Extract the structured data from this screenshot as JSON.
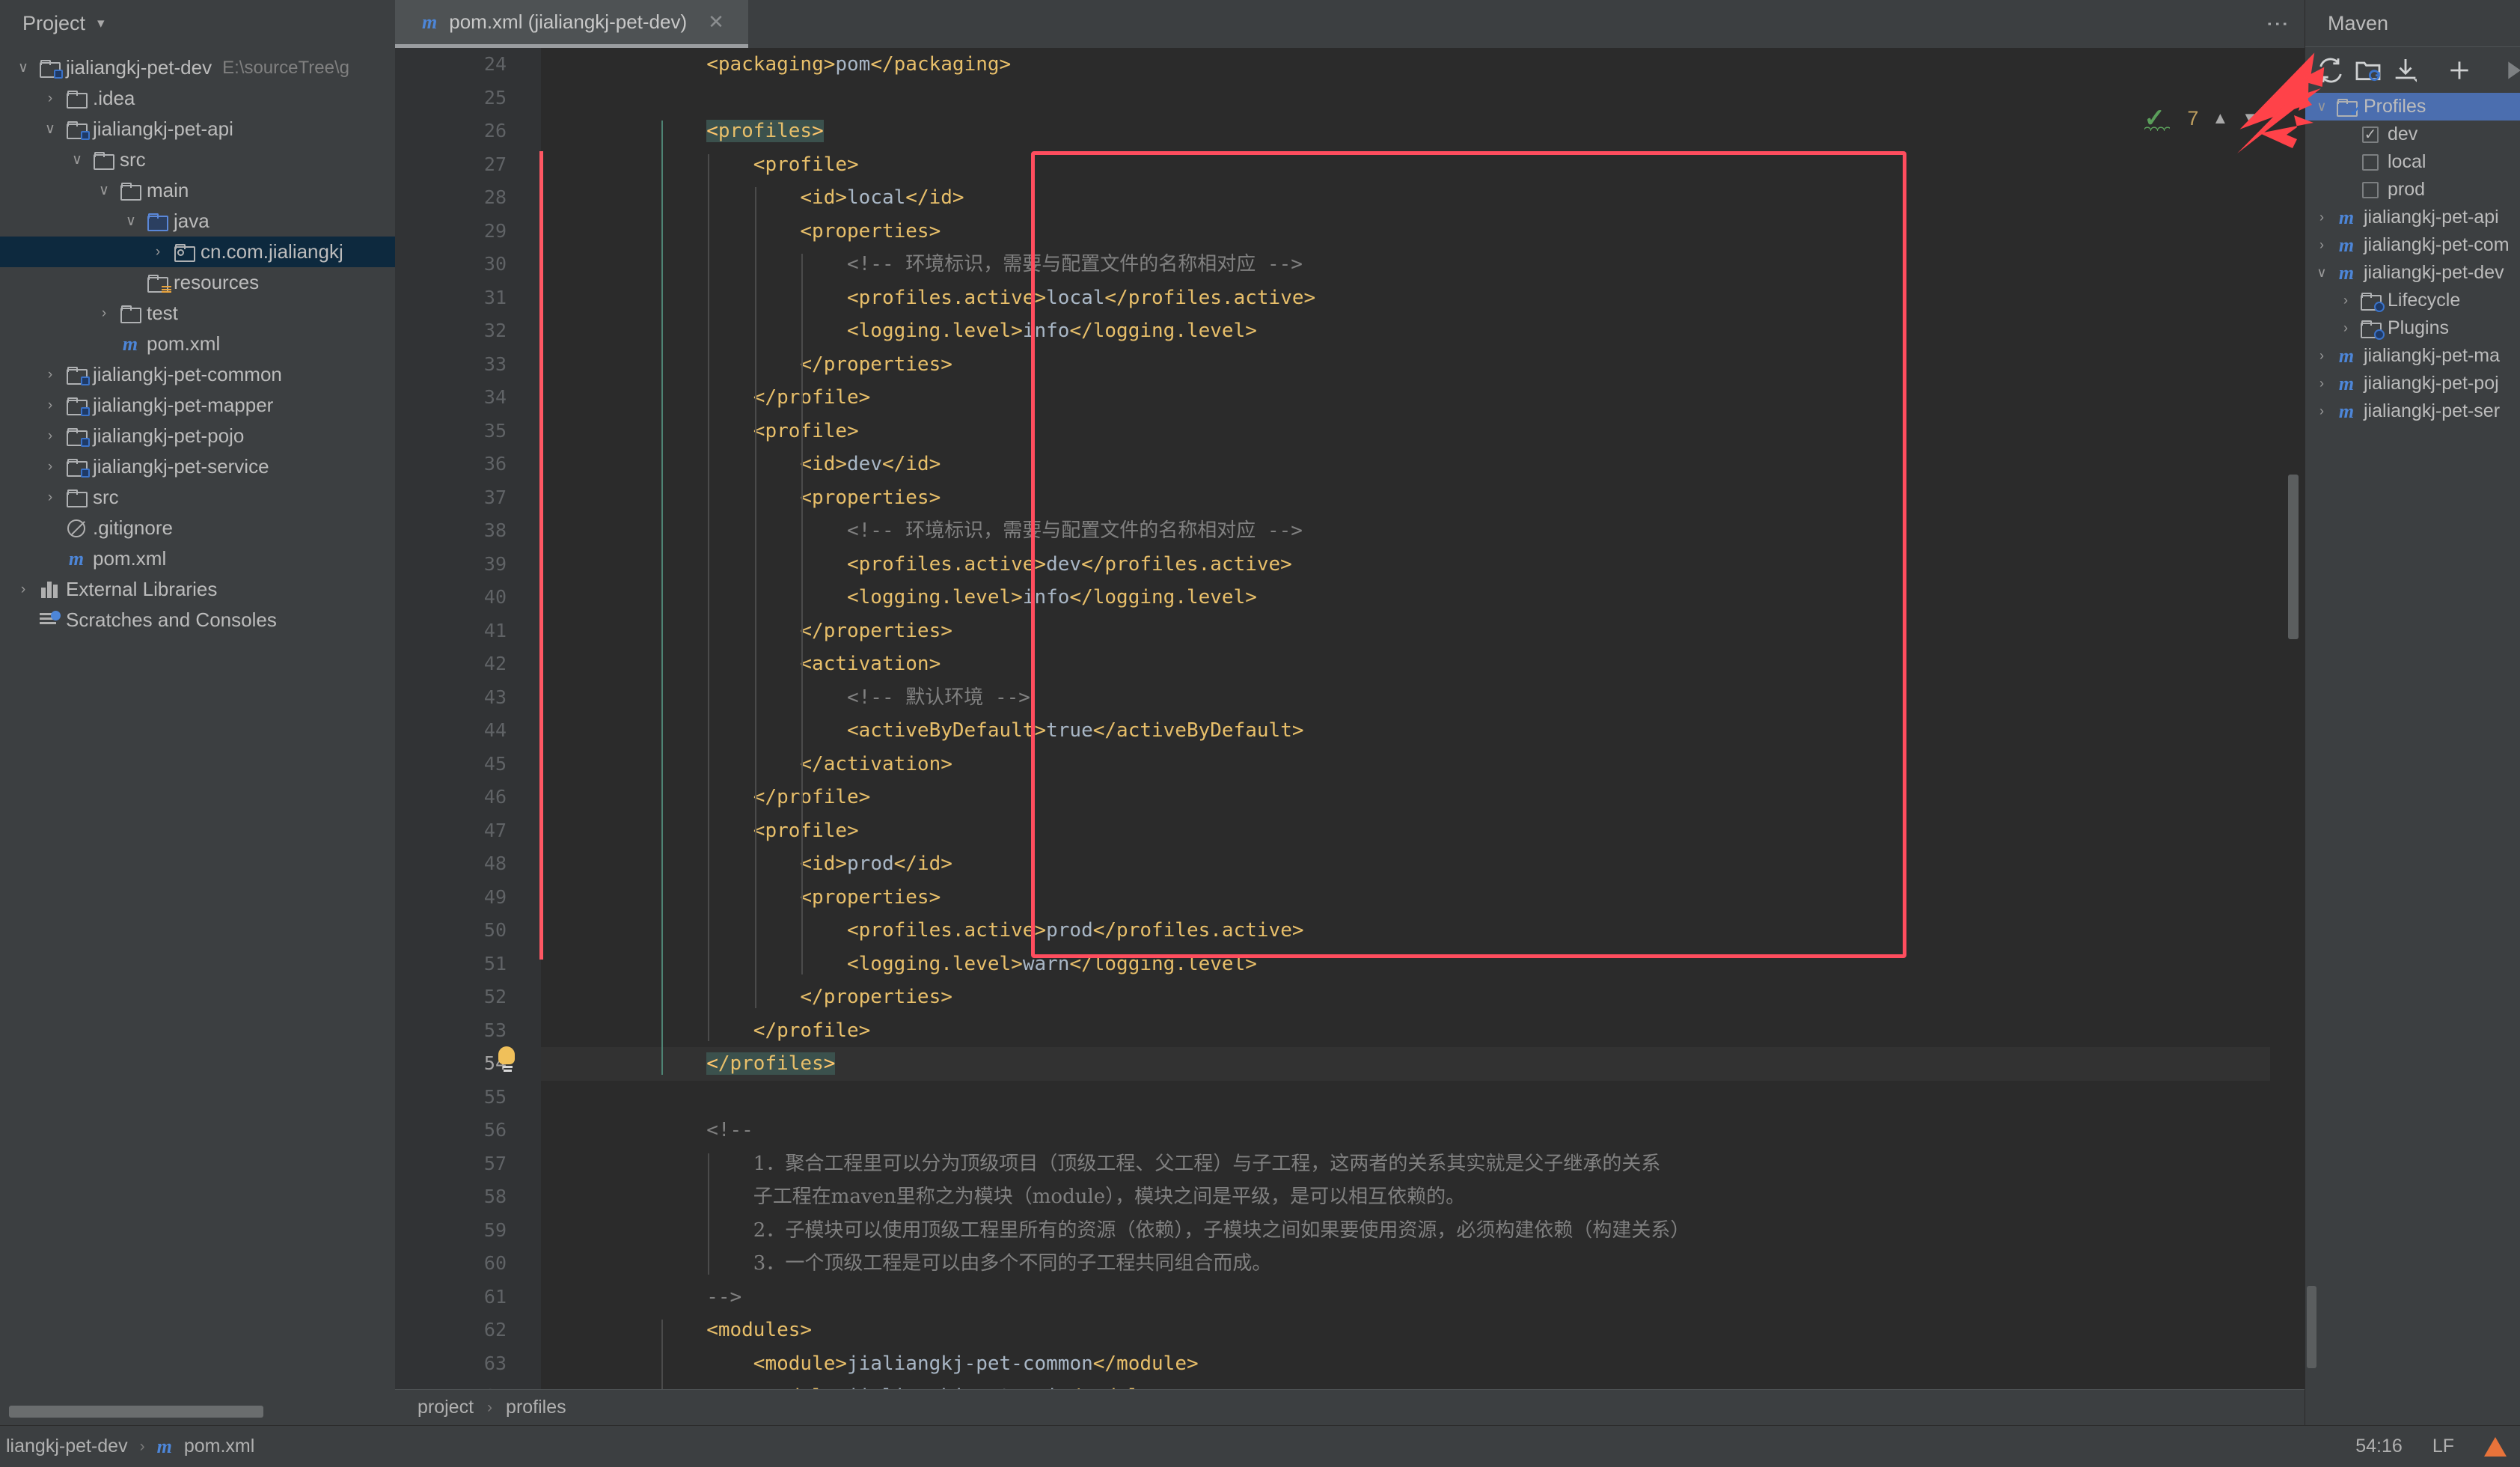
{
  "project_panel": {
    "title": "Project",
    "caret_icon": "chevron-down-icon",
    "tree": [
      {
        "id": "root",
        "label": "jialiangkj-pet-dev",
        "path": "E:\\sourceTree\\g",
        "indent": 0,
        "arrow": "v",
        "icon": "module-folder-icon"
      },
      {
        "id": "idea",
        "label": ".idea",
        "indent": 1,
        "arrow": ">",
        "icon": "folder-icon"
      },
      {
        "id": "api",
        "label": "jialiangkj-pet-api",
        "indent": 1,
        "arrow": "v",
        "icon": "module-folder-icon"
      },
      {
        "id": "src",
        "label": "src",
        "indent": 2,
        "arrow": "v",
        "icon": "folder-icon"
      },
      {
        "id": "main",
        "label": "main",
        "indent": 3,
        "arrow": "v",
        "icon": "folder-icon"
      },
      {
        "id": "java",
        "label": "java",
        "indent": 4,
        "arrow": "v",
        "icon": "source-folder-icon"
      },
      {
        "id": "pkg",
        "label": "cn.com.jialiangkj",
        "indent": 5,
        "arrow": ">",
        "icon": "package-icon",
        "selected": true
      },
      {
        "id": "resources",
        "label": "resources",
        "indent": 4,
        "arrow": "",
        "icon": "resources-folder-icon"
      },
      {
        "id": "test",
        "label": "test",
        "indent": 3,
        "arrow": ">",
        "icon": "folder-icon"
      },
      {
        "id": "api-pom",
        "label": "pom.xml",
        "indent": 3,
        "arrow": "",
        "icon": "maven-file-icon"
      },
      {
        "id": "common",
        "label": "jialiangkj-pet-common",
        "indent": 1,
        "arrow": ">",
        "icon": "module-folder-icon"
      },
      {
        "id": "mapper",
        "label": "jialiangkj-pet-mapper",
        "indent": 1,
        "arrow": ">",
        "icon": "module-folder-icon"
      },
      {
        "id": "pojo",
        "label": "jialiangkj-pet-pojo",
        "indent": 1,
        "arrow": ">",
        "icon": "module-folder-icon"
      },
      {
        "id": "service",
        "label": "jialiangkj-pet-service",
        "indent": 1,
        "arrow": ">",
        "icon": "module-folder-icon"
      },
      {
        "id": "rootsrc",
        "label": "src",
        "indent": 1,
        "arrow": ">",
        "icon": "folder-icon"
      },
      {
        "id": "gitignore",
        "label": ".gitignore",
        "indent": 1,
        "arrow": "",
        "icon": "gitignore-icon"
      },
      {
        "id": "rootpom",
        "label": "pom.xml",
        "indent": 1,
        "arrow": "",
        "icon": "maven-file-icon"
      },
      {
        "id": "extlibs",
        "label": "External Libraries",
        "indent": 0,
        "arrow": ">",
        "icon": "library-icon"
      },
      {
        "id": "scratches",
        "label": "Scratches and Consoles",
        "indent": 0,
        "arrow": "",
        "icon": "scratches-icon"
      }
    ]
  },
  "editor": {
    "tab": {
      "label": "pom.xml (jialiangkj-pet-dev)",
      "icon": "maven-file-icon",
      "close_icon": "close-icon"
    },
    "tab_options_icon": "more-options-icon",
    "inspection": {
      "count": "7",
      "status_icon": "inspection-ok-icon",
      "up_icon": "chevron-up-icon",
      "down_icon": "chevron-down-icon"
    },
    "first_line_number": 24,
    "current_line": 54,
    "bulb_icon": "intention-bulb-icon",
    "lines": [
      {
        "n": 24,
        "indent": 2,
        "parts": [
          {
            "t": "tag",
            "s": "<packaging>"
          },
          {
            "t": "val",
            "s": "pom"
          },
          {
            "t": "tag",
            "s": "</packaging>"
          }
        ]
      },
      {
        "n": 25,
        "indent": 0,
        "parts": []
      },
      {
        "n": 26,
        "indent": 2,
        "hl": true,
        "parts": [
          {
            "t": "brk",
            "s": "<"
          },
          {
            "t": "tag",
            "s": "profiles"
          },
          {
            "t": "brk",
            "s": ">"
          }
        ]
      },
      {
        "n": 27,
        "indent": 3,
        "parts": [
          {
            "t": "tag",
            "s": "<profile>"
          }
        ]
      },
      {
        "n": 28,
        "indent": 4,
        "parts": [
          {
            "t": "tag",
            "s": "<id>"
          },
          {
            "t": "val",
            "s": "local"
          },
          {
            "t": "tag",
            "s": "</id>"
          }
        ]
      },
      {
        "n": 29,
        "indent": 4,
        "parts": [
          {
            "t": "tag",
            "s": "<properties>"
          }
        ]
      },
      {
        "n": 30,
        "indent": 5,
        "parts": [
          {
            "t": "cmt",
            "s": "<!-- "
          },
          {
            "t": "cjk",
            "s": "环境标识，需要与配置文件的名称相对应"
          },
          {
            "t": "cmt",
            "s": " -->"
          }
        ]
      },
      {
        "n": 31,
        "indent": 5,
        "parts": [
          {
            "t": "tag",
            "s": "<profiles.active>"
          },
          {
            "t": "val",
            "s": "local"
          },
          {
            "t": "tag",
            "s": "</profiles.active>"
          }
        ]
      },
      {
        "n": 32,
        "indent": 5,
        "parts": [
          {
            "t": "tag",
            "s": "<logging.level>"
          },
          {
            "t": "val",
            "s": "info"
          },
          {
            "t": "tag",
            "s": "</logging.level>"
          }
        ]
      },
      {
        "n": 33,
        "indent": 4,
        "parts": [
          {
            "t": "tag",
            "s": "</properties>"
          }
        ]
      },
      {
        "n": 34,
        "indent": 3,
        "parts": [
          {
            "t": "tag",
            "s": "</profile>"
          }
        ]
      },
      {
        "n": 35,
        "indent": 3,
        "parts": [
          {
            "t": "tag",
            "s": "<profile>"
          }
        ]
      },
      {
        "n": 36,
        "indent": 4,
        "parts": [
          {
            "t": "tag",
            "s": "<id>"
          },
          {
            "t": "val",
            "s": "dev"
          },
          {
            "t": "tag",
            "s": "</id>"
          }
        ]
      },
      {
        "n": 37,
        "indent": 4,
        "parts": [
          {
            "t": "tag",
            "s": "<properties>"
          }
        ]
      },
      {
        "n": 38,
        "indent": 5,
        "parts": [
          {
            "t": "cmt",
            "s": "<!-- "
          },
          {
            "t": "cjk",
            "s": "环境标识，需要与配置文件的名称相对应"
          },
          {
            "t": "cmt",
            "s": " -->"
          }
        ]
      },
      {
        "n": 39,
        "indent": 5,
        "parts": [
          {
            "t": "tag",
            "s": "<profiles.active>"
          },
          {
            "t": "val",
            "s": "dev"
          },
          {
            "t": "tag",
            "s": "</profiles.active>"
          }
        ]
      },
      {
        "n": 40,
        "indent": 5,
        "parts": [
          {
            "t": "tag",
            "s": "<logging.level>"
          },
          {
            "t": "val",
            "s": "info"
          },
          {
            "t": "tag",
            "s": "</logging.level>"
          }
        ]
      },
      {
        "n": 41,
        "indent": 4,
        "parts": [
          {
            "t": "tag",
            "s": "</properties>"
          }
        ]
      },
      {
        "n": 42,
        "indent": 4,
        "parts": [
          {
            "t": "tag",
            "s": "<activation>"
          }
        ]
      },
      {
        "n": 43,
        "indent": 5,
        "parts": [
          {
            "t": "cmt",
            "s": "<!-- "
          },
          {
            "t": "cjk",
            "s": "默认环境"
          },
          {
            "t": "cmt",
            "s": " -->"
          }
        ]
      },
      {
        "n": 44,
        "indent": 5,
        "parts": [
          {
            "t": "tag",
            "s": "<activeByDefault>"
          },
          {
            "t": "val",
            "s": "true"
          },
          {
            "t": "tag",
            "s": "</activeByDefault>"
          }
        ]
      },
      {
        "n": 45,
        "indent": 4,
        "parts": [
          {
            "t": "tag",
            "s": "</activation>"
          }
        ]
      },
      {
        "n": 46,
        "indent": 3,
        "parts": [
          {
            "t": "tag",
            "s": "</profile>"
          }
        ]
      },
      {
        "n": 47,
        "indent": 3,
        "parts": [
          {
            "t": "tag",
            "s": "<profile>"
          }
        ]
      },
      {
        "n": 48,
        "indent": 4,
        "parts": [
          {
            "t": "tag",
            "s": "<id>"
          },
          {
            "t": "val",
            "s": "prod"
          },
          {
            "t": "tag",
            "s": "</id>"
          }
        ]
      },
      {
        "n": 49,
        "indent": 4,
        "parts": [
          {
            "t": "tag",
            "s": "<properties>"
          }
        ]
      },
      {
        "n": 50,
        "indent": 5,
        "parts": [
          {
            "t": "tag",
            "s": "<profiles.active>"
          },
          {
            "t": "val",
            "s": "prod"
          },
          {
            "t": "tag",
            "s": "</profiles.active>"
          }
        ]
      },
      {
        "n": 51,
        "indent": 5,
        "parts": [
          {
            "t": "tag",
            "s": "<logging.level>"
          },
          {
            "t": "val",
            "s": "warn"
          },
          {
            "t": "tag",
            "s": "</logging.level>"
          }
        ]
      },
      {
        "n": 52,
        "indent": 4,
        "parts": [
          {
            "t": "tag",
            "s": "</properties>"
          }
        ]
      },
      {
        "n": 53,
        "indent": 3,
        "parts": [
          {
            "t": "tag",
            "s": "</profile>"
          }
        ]
      },
      {
        "n": 54,
        "indent": 2,
        "hl": true,
        "current": true,
        "parts": [
          {
            "t": "brk",
            "s": "<"
          },
          {
            "t": "tag",
            "s": "/profiles"
          },
          {
            "t": "brk",
            "s": ">"
          }
        ]
      },
      {
        "n": 55,
        "indent": 0,
        "parts": []
      },
      {
        "n": 56,
        "indent": 2,
        "parts": [
          {
            "t": "cmt",
            "s": "<!--"
          }
        ]
      },
      {
        "n": 57,
        "indent": 3,
        "parts": [
          {
            "t": "cjk",
            "s": "1．聚合工程里可以分为顶级项目（顶级工程、父工程）与子工程，这两者的关系其实就是父子继承的关系"
          }
        ]
      },
      {
        "n": 58,
        "indent": 3,
        "parts": [
          {
            "t": "cjk",
            "s": "子工程在maven里称之为模块（module），模块之间是平级，是可以相互依赖的。"
          }
        ]
      },
      {
        "n": 59,
        "indent": 3,
        "parts": [
          {
            "t": "cjk",
            "s": "2．子模块可以使用顶级工程里所有的资源（依赖），子模块之间如果要使用资源，必须构建依赖（构建关系）"
          }
        ]
      },
      {
        "n": 60,
        "indent": 3,
        "parts": [
          {
            "t": "cjk",
            "s": "3．一个顶级工程是可以由多个不同的子工程共同组合而成。"
          }
        ]
      },
      {
        "n": 61,
        "indent": 2,
        "parts": [
          {
            "t": "cmt",
            "s": "-->"
          }
        ]
      },
      {
        "n": 62,
        "indent": 2,
        "parts": [
          {
            "t": "tag",
            "s": "<modules>"
          }
        ]
      },
      {
        "n": 63,
        "indent": 3,
        "parts": [
          {
            "t": "tag",
            "s": "<module>"
          },
          {
            "t": "val",
            "s": "jialiangkj-pet-common"
          },
          {
            "t": "tag",
            "s": "</module>"
          }
        ]
      },
      {
        "n": 64,
        "indent": 3,
        "parts": [
          {
            "t": "tag",
            "s": "<module>"
          },
          {
            "t": "val",
            "s": "jialiangkj-pet-api"
          },
          {
            "t": "tag",
            "s": "</module>"
          }
        ]
      }
    ],
    "breadcrumb": [
      "project",
      "profiles"
    ],
    "breadcrumb_sep": "›"
  },
  "maven_panel": {
    "title": "Maven",
    "toolbar": [
      {
        "id": "reload",
        "icon": "reload-all-maven-projects-icon"
      },
      {
        "id": "add-maven-project",
        "icon": "add-maven-project-folder-icon"
      },
      {
        "id": "download-sources",
        "icon": "download-sources-icon"
      },
      {
        "id": "add-goal",
        "icon": "plus-icon"
      },
      {
        "id": "run-goal",
        "icon": "run-icon"
      }
    ],
    "tree": [
      {
        "id": "profiles",
        "label": "Profiles",
        "indent": 0,
        "arrow": "v",
        "icon": "profiles-folder-icon",
        "selected": true
      },
      {
        "id": "dev",
        "label": "dev",
        "indent": 1,
        "arrow": "",
        "icon": "checkbox-checked-icon",
        "checked": true
      },
      {
        "id": "local",
        "label": "local",
        "indent": 1,
        "arrow": "",
        "icon": "checkbox-icon",
        "checked": false
      },
      {
        "id": "prod",
        "label": "prod",
        "indent": 1,
        "arrow": "",
        "icon": "checkbox-icon",
        "checked": false
      },
      {
        "id": "m-api",
        "label": "jialiangkj-pet-api",
        "indent": 0,
        "arrow": ">",
        "icon": "maven-file-icon"
      },
      {
        "id": "m-common",
        "label": "jialiangkj-pet-com",
        "indent": 0,
        "arrow": ">",
        "icon": "maven-file-icon"
      },
      {
        "id": "m-dev",
        "label": "jialiangkj-pet-dev",
        "indent": 0,
        "arrow": "v",
        "icon": "maven-file-icon"
      },
      {
        "id": "lifecycle",
        "label": "Lifecycle",
        "indent": 1,
        "arrow": ">",
        "icon": "lifecycle-folder-icon"
      },
      {
        "id": "plugins",
        "label": "Plugins",
        "indent": 1,
        "arrow": ">",
        "icon": "plugins-folder-icon"
      },
      {
        "id": "m-mapper",
        "label": "jialiangkj-pet-ma",
        "indent": 0,
        "arrow": ">",
        "icon": "maven-file-icon"
      },
      {
        "id": "m-pojo",
        "label": "jialiangkj-pet-poj",
        "indent": 0,
        "arrow": ">",
        "icon": "maven-file-icon"
      },
      {
        "id": "m-service",
        "label": "jialiangkj-pet-ser",
        "indent": 0,
        "arrow": ">",
        "icon": "maven-file-icon"
      }
    ]
  },
  "statusbar": {
    "breadcrumb": [
      "liangkj-pet-dev",
      "pom.xml"
    ],
    "breadcrumb_sep": "›",
    "file_icon": "maven-file-icon",
    "caret_position": "54:16",
    "line_separator": "LF",
    "warning_icon": "warning-icon"
  },
  "annotations": {
    "accent_red": "#ff4d5e",
    "arrow_count": 2
  }
}
